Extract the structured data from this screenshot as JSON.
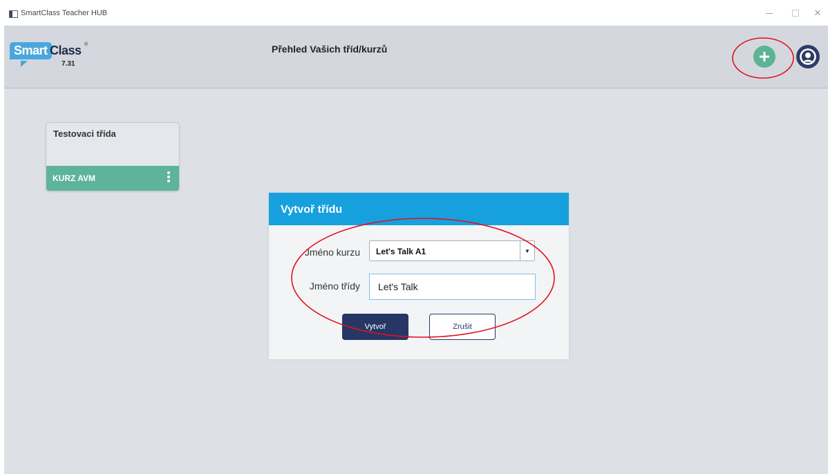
{
  "window": {
    "title": "SmartClass Teacher HUB",
    "minimize_glyph": "–",
    "maximize_glyph": "□",
    "close_glyph": "✕"
  },
  "header": {
    "logo_smart": "Smart",
    "logo_class": "Class",
    "logo_registered": "®",
    "version": "7.31",
    "page_title": "Přehled Vašich tříd/kurzů",
    "add_icon": "plus-icon",
    "profile_icon": "user-circle-icon"
  },
  "classes": [
    {
      "title": "Testovaci třída",
      "course": "KURZ AVM"
    }
  ],
  "dialog": {
    "title": "Vytvoř třídu",
    "course_label": "Jméno kurzu",
    "course_value": "Let's Talk A1",
    "class_label": "Jméno třídy",
    "class_value": "Let's Talk",
    "create_label": "Vytvoř",
    "cancel_label": "Zrušit"
  },
  "colors": {
    "accent": "#16a0de",
    "add_button": "#5cb396",
    "card_footer": "#5db498",
    "primary_dark": "#263766",
    "annotation": "#e0101c"
  }
}
